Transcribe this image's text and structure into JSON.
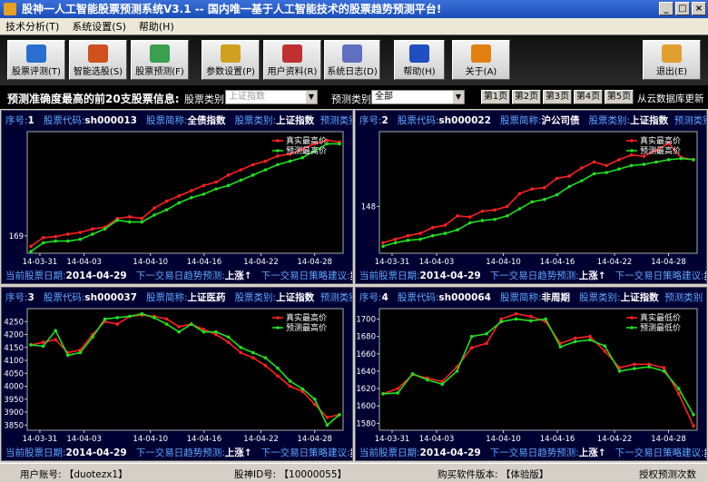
{
  "window": {
    "title": "股神一人工智能股票预测系统V3.1    -- 国内唯一基于人工智能技术的股票趋势预测平台!"
  },
  "menu": [
    "技术分析(T)",
    "系统设置(S)",
    "帮助(H)"
  ],
  "toolbar": [
    {
      "label": "股票评测(T)",
      "icon": "graduation-icon",
      "color": "#2a6fd0"
    },
    {
      "label": "智能选股(S)",
      "icon": "chart-search-icon",
      "color": "#d05020"
    },
    {
      "label": "股票预测(F)",
      "icon": "forecast-chart-icon",
      "color": "#3aa050"
    },
    {
      "label": "参数设置(P)",
      "icon": "gears-icon",
      "color": "#d0a020"
    },
    {
      "label": "用户资料(R)",
      "icon": "user-icon",
      "color": "#c03030"
    },
    {
      "label": "系统日志(D)",
      "icon": "log-icon",
      "color": "#6070c0"
    },
    {
      "label": "帮助(H)",
      "icon": "help-icon",
      "color": "#2050c0"
    },
    {
      "label": "关于(A)",
      "icon": "info-icon",
      "color": "#e08010"
    },
    {
      "label": "退出(E)",
      "icon": "exit-door-icon",
      "color": "#e0a030"
    }
  ],
  "info": {
    "heading": "预测准确度最高的前20支股票信息:",
    "stock_type_label": "股票类别:",
    "stock_type_value": "上证指数",
    "predict_type_label": "预测类别:",
    "predict_type_value": "全部",
    "pages": [
      "第1页",
      "第2页",
      "第3页",
      "第4页",
      "第5页"
    ],
    "cloud_update": "从云数据库更新"
  },
  "panel_labels": {
    "seq": "序号:",
    "code": "股票代码:",
    "name": "股票简称:",
    "cat": "股票类别:",
    "cat2": "预测类别",
    "date": "当前股票日期:",
    "trend": "下一交易日趋势预测:",
    "advice": "下一交易日策略建议:"
  },
  "panels": [
    {
      "seq": "1",
      "code": "sh000013",
      "name": "全债指数",
      "cat": "上证指数",
      "date": "2014-04-29",
      "trend": "上涨",
      "advice": "卖"
    },
    {
      "seq": "2",
      "code": "sh000022",
      "name": "沪公司债",
      "cat": "上证指数",
      "date": "2014-04-29",
      "trend": "上涨",
      "advice": "卖"
    },
    {
      "seq": "3",
      "code": "sh000037",
      "name": "上证医药",
      "cat": "上证指数",
      "date": "2014-04-29",
      "trend": "上涨",
      "advice": "卖"
    },
    {
      "seq": "4",
      "code": "sh000064",
      "name": "非周期",
      "cat": "上证指数",
      "date": "2014-04-29",
      "trend": "上涨",
      "advice": "卖"
    }
  ],
  "chart_data": [
    {
      "type": "line",
      "x": [
        "14-03-31",
        "14-04-03",
        "14-04-10",
        "14-04-16",
        "14-04-22",
        "14-04-28"
      ],
      "ylim": [
        168.5,
        172.0
      ],
      "yticks": [
        169
      ],
      "series": [
        {
          "name": "真实最高价",
          "color": "#ff2020",
          "values": [
            168.7,
            168.95,
            168.98,
            169.05,
            169.1,
            169.2,
            169.25,
            169.5,
            169.55,
            169.5,
            169.8,
            170.0,
            170.15,
            170.3,
            170.45,
            170.55,
            170.75,
            170.9,
            171.05,
            171.15,
            171.3,
            171.35,
            171.5,
            171.65,
            171.75,
            171.7
          ]
        },
        {
          "name": "预测最高价",
          "color": "#20e020",
          "values": [
            168.55,
            168.8,
            168.85,
            168.85,
            168.9,
            169.05,
            169.2,
            169.45,
            169.4,
            169.4,
            169.6,
            169.75,
            169.95,
            170.1,
            170.2,
            170.35,
            170.45,
            170.6,
            170.75,
            170.9,
            171.05,
            171.15,
            171.25,
            171.45,
            171.65,
            171.65
          ]
        }
      ]
    },
    {
      "type": "line",
      "x": [
        "14-03-31",
        "14-04-03",
        "14-04-10",
        "14-04-16",
        "14-04-22",
        "14-04-28"
      ],
      "ylim": [
        146.0,
        151.2
      ],
      "yticks": [
        148
      ],
      "series": [
        {
          "name": "真实最高价",
          "color": "#ff2020",
          "values": [
            146.45,
            146.6,
            146.75,
            146.85,
            147.1,
            147.2,
            147.6,
            147.55,
            147.8,
            147.85,
            148.0,
            148.55,
            148.75,
            148.8,
            149.2,
            149.3,
            149.65,
            149.9,
            149.75,
            150.0,
            150.2,
            150.15,
            150.4,
            150.7,
            150.1,
            150.0
          ]
        },
        {
          "name": "预测最高价",
          "color": "#20e020",
          "values": [
            146.3,
            146.45,
            146.55,
            146.6,
            146.75,
            146.85,
            147.0,
            147.3,
            147.4,
            147.45,
            147.6,
            147.9,
            148.2,
            148.3,
            148.5,
            148.85,
            149.1,
            149.4,
            149.45,
            149.6,
            149.75,
            149.8,
            149.9,
            150.0,
            150.05,
            150.0
          ]
        }
      ]
    },
    {
      "type": "line",
      "x": [
        "14-03-31",
        "14-04-03",
        "14-04-10",
        "14-04-16",
        "14-04-22",
        "14-04-28"
      ],
      "ylim": [
        3830,
        4300
      ],
      "yticks": [
        3850,
        3900,
        3950,
        4000,
        4050,
        4100,
        4150,
        4200,
        4250
      ],
      "series": [
        {
          "name": "真实最高价",
          "color": "#ff2020",
          "values": [
            4160,
            4170,
            4180,
            4130,
            4140,
            4200,
            4250,
            4240,
            4270,
            4275,
            4270,
            4260,
            4230,
            4240,
            4220,
            4200,
            4170,
            4130,
            4110,
            4080,
            4040,
            4000,
            3980,
            3930,
            3880,
            3890
          ]
        },
        {
          "name": "预测最高价",
          "color": "#20e020",
          "values": [
            4160,
            4155,
            4215,
            4120,
            4130,
            4190,
            4260,
            4265,
            4270,
            4280,
            4265,
            4240,
            4210,
            4240,
            4210,
            4210,
            4190,
            4150,
            4130,
            4110,
            4070,
            4020,
            3990,
            3950,
            3850,
            3890
          ]
        }
      ]
    },
    {
      "type": "line",
      "x": [
        "14-03-31",
        "14-04-03",
        "14-04-10",
        "14-04-16",
        "14-04-22",
        "14-04-28"
      ],
      "ylim": [
        1572,
        1712
      ],
      "yticks": [
        1580,
        1600,
        1620,
        1640,
        1660,
        1680,
        1700
      ],
      "series": [
        {
          "name": "真实最低价",
          "color": "#ff2020",
          "values": [
            1614,
            1620,
            1636,
            1632,
            1628,
            1645,
            1667,
            1672,
            1700,
            1706,
            1703,
            1697,
            1672,
            1678,
            1680,
            1663,
            1644,
            1648,
            1648,
            1644,
            1614,
            1577
          ]
        },
        {
          "name": "预测最低价",
          "color": "#20e020",
          "values": [
            1614,
            1615,
            1637,
            1630,
            1625,
            1640,
            1680,
            1683,
            1697,
            1700,
            1698,
            1700,
            1668,
            1674,
            1676,
            1669,
            1640,
            1643,
            1645,
            1640,
            1620,
            1590
          ]
        }
      ]
    }
  ]
}
